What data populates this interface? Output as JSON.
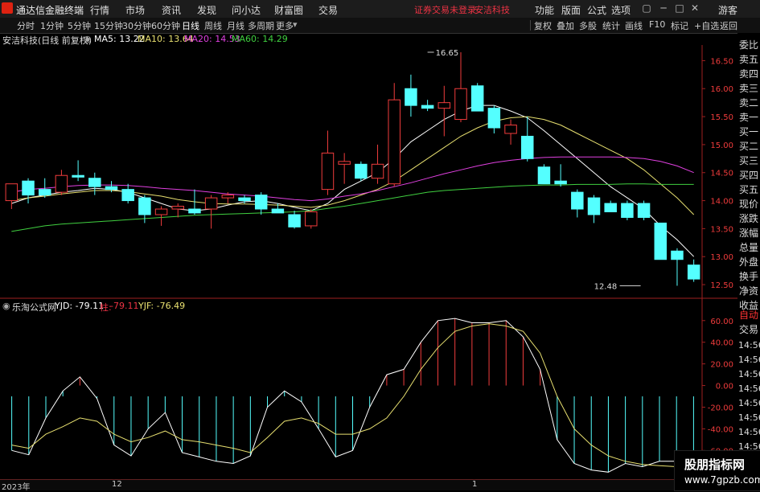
{
  "menubar": {
    "app_title": "通达信金融终端",
    "items": [
      "行情",
      "市场",
      "资讯",
      "发现",
      "问小达",
      "财富圈",
      "交易"
    ],
    "notice": "证券交易未登录",
    "stock": "安洁科技",
    "right_items": [
      "功能",
      "版面",
      "公式",
      "选项"
    ],
    "guest": "游客"
  },
  "toolbar": {
    "timeframes": [
      "分时",
      "1分钟",
      "5分钟",
      "15分钟",
      "30分钟",
      "60分钟",
      "日线",
      "周线",
      "月线",
      "多周期",
      "更多"
    ],
    "active_timeframe": "日线",
    "right_buttons": [
      "复权",
      "叠加",
      "多股",
      "统计",
      "画线",
      "F10",
      "标记",
      "+自选",
      "返回"
    ]
  },
  "main_info": {
    "title": "安洁科技(日线 前复权)",
    "ma5": "MA5: 13.22",
    "ma10": "MA10: 13.64",
    "ma20": "MA20: 14.53",
    "ma60": "MA60: 14.29",
    "colors": {
      "ma5": "#ffffff",
      "ma10": "#e8e070",
      "ma20": "#e040e0",
      "ma60": "#40d040"
    }
  },
  "sub_info": {
    "title": "乐淘公式网",
    "yjd": "YJD: -79.11",
    "zhu_label": "柱:",
    "zhu_value": "-79.11",
    "yjf": "YJF: -76.49"
  },
  "side_tabs": [
    "委比",
    "卖五",
    "卖四",
    "卖三",
    "卖二",
    "卖一",
    "买一",
    "买二",
    "买三",
    "买四",
    "买五",
    "现价",
    "涨跌",
    "涨幅",
    "总量",
    "外盘",
    "换手",
    "净资",
    "收益"
  ],
  "side_tabs_lower": [
    "自动",
    "交易"
  ],
  "side_rows": [
    "14:56",
    "14:56",
    "14:56",
    "14:56",
    "14:56",
    "14:56",
    "14:56",
    "14:56",
    "14:56",
    "14:56",
    "14:56",
    "14:56"
  ],
  "bottom_bar": {
    "year": "2023年",
    "m12": "12",
    "m1": "1"
  },
  "watermark": {
    "line1": "股朋指标网",
    "line2": "www.7gpzb.com"
  },
  "chart_data": [
    {
      "type": "candlestick",
      "title": "安洁科技(日线 前复权)",
      "ylim": [
        12.3,
        16.75
      ],
      "yticks": [
        16.5,
        16.0,
        15.5,
        15.0,
        14.5,
        14.0,
        13.5,
        13.0,
        12.5
      ],
      "ytick_labels": [
        "16.50",
        "16.00",
        "15.50",
        "15.00",
        "14.50",
        "14.00",
        "13.50",
        "13.00",
        "12.50"
      ],
      "annotations": [
        {
          "label": "16.65",
          "value": 16.65,
          "candle": 25
        },
        {
          "label": "12.48",
          "value": 12.48,
          "candle": 38
        }
      ],
      "candles": [
        {
          "o": 14.0,
          "h": 14.2,
          "l": 13.85,
          "c": 14.3
        },
        {
          "o": 14.35,
          "h": 14.4,
          "l": 13.95,
          "c": 14.1
        },
        {
          "o": 14.2,
          "h": 14.4,
          "l": 14.05,
          "c": 14.1
        },
        {
          "o": 14.15,
          "h": 14.55,
          "l": 14.1,
          "c": 14.45
        },
        {
          "o": 14.45,
          "h": 14.72,
          "l": 14.35,
          "c": 14.42
        },
        {
          "o": 14.4,
          "h": 14.5,
          "l": 14.1,
          "c": 14.25
        },
        {
          "o": 14.25,
          "h": 14.35,
          "l": 14.15,
          "c": 14.2
        },
        {
          "o": 14.2,
          "h": 14.3,
          "l": 13.95,
          "c": 14.0
        },
        {
          "o": 14.05,
          "h": 14.1,
          "l": 13.6,
          "c": 13.75
        },
        {
          "o": 13.75,
          "h": 13.9,
          "l": 13.55,
          "c": 13.85
        },
        {
          "o": 13.85,
          "h": 13.95,
          "l": 13.7,
          "c": 13.9
        },
        {
          "o": 13.85,
          "h": 14.2,
          "l": 13.75,
          "c": 13.78
        },
        {
          "o": 13.85,
          "h": 14.1,
          "l": 13.5,
          "c": 14.05
        },
        {
          "o": 14.05,
          "h": 14.15,
          "l": 13.95,
          "c": 14.1
        },
        {
          "o": 14.05,
          "h": 14.1,
          "l": 13.95,
          "c": 14.0
        },
        {
          "o": 14.1,
          "h": 14.15,
          "l": 13.75,
          "c": 13.85
        },
        {
          "o": 13.85,
          "h": 13.95,
          "l": 13.8,
          "c": 13.78
        },
        {
          "o": 13.75,
          "h": 13.82,
          "l": 13.5,
          "c": 13.53
        },
        {
          "o": 13.55,
          "h": 13.85,
          "l": 13.5,
          "c": 13.8
        },
        {
          "o": 14.2,
          "h": 15.25,
          "l": 14.1,
          "c": 14.85
        },
        {
          "o": 14.65,
          "h": 14.85,
          "l": 14.3,
          "c": 14.7
        },
        {
          "o": 14.65,
          "h": 14.7,
          "l": 14.35,
          "c": 14.4
        },
        {
          "o": 14.4,
          "h": 15.0,
          "l": 14.3,
          "c": 14.65
        },
        {
          "o": 14.3,
          "h": 16.1,
          "l": 14.25,
          "c": 15.8
        },
        {
          "o": 16.0,
          "h": 16.25,
          "l": 15.5,
          "c": 15.7
        },
        {
          "o": 15.7,
          "h": 15.8,
          "l": 15.6,
          "c": 15.65
        },
        {
          "o": 15.65,
          "h": 16.05,
          "l": 15.15,
          "c": 15.75
        },
        {
          "o": 15.45,
          "h": 16.65,
          "l": 15.4,
          "c": 16.0
        },
        {
          "o": 16.05,
          "h": 16.1,
          "l": 15.6,
          "c": 15.6
        },
        {
          "o": 15.65,
          "h": 15.7,
          "l": 15.2,
          "c": 15.3
        },
        {
          "o": 15.2,
          "h": 15.45,
          "l": 15.0,
          "c": 15.35
        },
        {
          "o": 15.15,
          "h": 15.5,
          "l": 14.7,
          "c": 14.75
        },
        {
          "o": 14.6,
          "h": 14.65,
          "l": 14.3,
          "c": 14.3
        },
        {
          "o": 14.35,
          "h": 14.65,
          "l": 14.25,
          "c": 14.3
        },
        {
          "o": 14.15,
          "h": 14.2,
          "l": 13.7,
          "c": 13.85
        },
        {
          "o": 14.05,
          "h": 14.1,
          "l": 13.6,
          "c": 13.75
        },
        {
          "o": 13.95,
          "h": 14.0,
          "l": 13.8,
          "c": 13.8
        },
        {
          "o": 13.95,
          "h": 14.0,
          "l": 13.65,
          "c": 13.7
        },
        {
          "o": 13.95,
          "h": 14.0,
          "l": 13.65,
          "c": 13.7
        },
        {
          "o": 13.6,
          "h": 13.6,
          "l": 12.95,
          "c": 12.95
        },
        {
          "o": 13.1,
          "h": 13.15,
          "l": 12.48,
          "c": 12.95
        },
        {
          "o": 12.85,
          "h": 12.95,
          "l": 12.55,
          "c": 12.6
        }
      ],
      "series": [
        {
          "name": "MA5",
          "values": [
            13.95,
            14.05,
            14.1,
            14.15,
            14.18,
            14.22,
            14.2,
            14.15,
            14.05,
            13.95,
            13.85,
            13.82,
            13.85,
            13.92,
            13.98,
            14.0,
            13.95,
            13.88,
            13.82,
            13.95,
            14.2,
            14.35,
            14.5,
            14.75,
            15.05,
            15.25,
            15.45,
            15.6,
            15.7,
            15.7,
            15.6,
            15.48,
            15.25,
            15.0,
            14.75,
            14.5,
            14.25,
            14.05,
            13.85,
            13.55,
            13.3,
            13.0
          ]
        },
        {
          "name": "MA10",
          "values": [
            14.0,
            14.05,
            14.08,
            14.12,
            14.15,
            14.18,
            14.18,
            14.16,
            14.12,
            14.08,
            14.02,
            13.98,
            13.95,
            13.94,
            13.94,
            13.93,
            13.92,
            13.9,
            13.88,
            13.92,
            14.0,
            14.1,
            14.2,
            14.35,
            14.55,
            14.75,
            14.95,
            15.15,
            15.3,
            15.42,
            15.48,
            15.5,
            15.45,
            15.35,
            15.2,
            15.05,
            14.9,
            14.75,
            14.55,
            14.3,
            14.05,
            13.75
          ]
        },
        {
          "name": "MA20",
          "values": [
            14.15,
            14.2,
            14.22,
            14.25,
            14.27,
            14.28,
            14.28,
            14.27,
            14.25,
            14.22,
            14.2,
            14.18,
            14.15,
            14.12,
            14.1,
            14.08,
            14.05,
            14.02,
            14.0,
            14.03,
            14.08,
            14.12,
            14.18,
            14.25,
            14.32,
            14.4,
            14.48,
            14.55,
            14.62,
            14.68,
            14.72,
            14.75,
            14.77,
            14.78,
            14.78,
            14.78,
            14.78,
            14.77,
            14.75,
            14.7,
            14.62,
            14.5
          ]
        },
        {
          "name": "MA60",
          "values": [
            13.45,
            13.5,
            13.55,
            13.58,
            13.6,
            13.62,
            13.64,
            13.66,
            13.68,
            13.7,
            13.72,
            13.74,
            13.75,
            13.76,
            13.77,
            13.78,
            13.79,
            13.8,
            13.82,
            13.86,
            13.9,
            13.95,
            14.0,
            14.05,
            14.1,
            14.15,
            14.18,
            14.2,
            14.22,
            14.24,
            14.26,
            14.27,
            14.28,
            14.28,
            14.29,
            14.29,
            14.29,
            14.3,
            14.3,
            14.29,
            14.29,
            14.29
          ]
        }
      ]
    },
    {
      "type": "bar-line",
      "title": "乐淘公式网",
      "ylim": [
        -85,
        68
      ],
      "yticks": [
        60,
        40,
        20,
        0,
        -20,
        -40,
        -60
      ],
      "ytick_labels": [
        "60.00",
        "40.00",
        "20.00",
        "0.00",
        "-20.00",
        "-40.00",
        "-60.00"
      ],
      "series": [
        {
          "name": "YJD",
          "values": [
            -60,
            -64,
            -30,
            -5,
            8,
            -12,
            -55,
            -65,
            -40,
            -25,
            -62,
            -66,
            -70,
            -72,
            -65,
            -20,
            -5,
            -15,
            -40,
            -66,
            -60,
            -20,
            10,
            15,
            40,
            60,
            62,
            58,
            58,
            60,
            45,
            15,
            -50,
            -72,
            -78,
            -80,
            -72,
            -75,
            -70,
            -70,
            -79.11
          ]
        },
        {
          "name": "YJF",
          "values": [
            -55,
            -58,
            -45,
            -38,
            -30,
            -33,
            -45,
            -52,
            -48,
            -42,
            -50,
            -52,
            -55,
            -58,
            -62,
            -48,
            -33,
            -30,
            -35,
            -45,
            -45,
            -40,
            -30,
            -10,
            15,
            35,
            50,
            55,
            57,
            55,
            50,
            30,
            -10,
            -40,
            -55,
            -65,
            -70,
            -73,
            -74,
            -75,
            -76.49
          ]
        }
      ]
    }
  ]
}
